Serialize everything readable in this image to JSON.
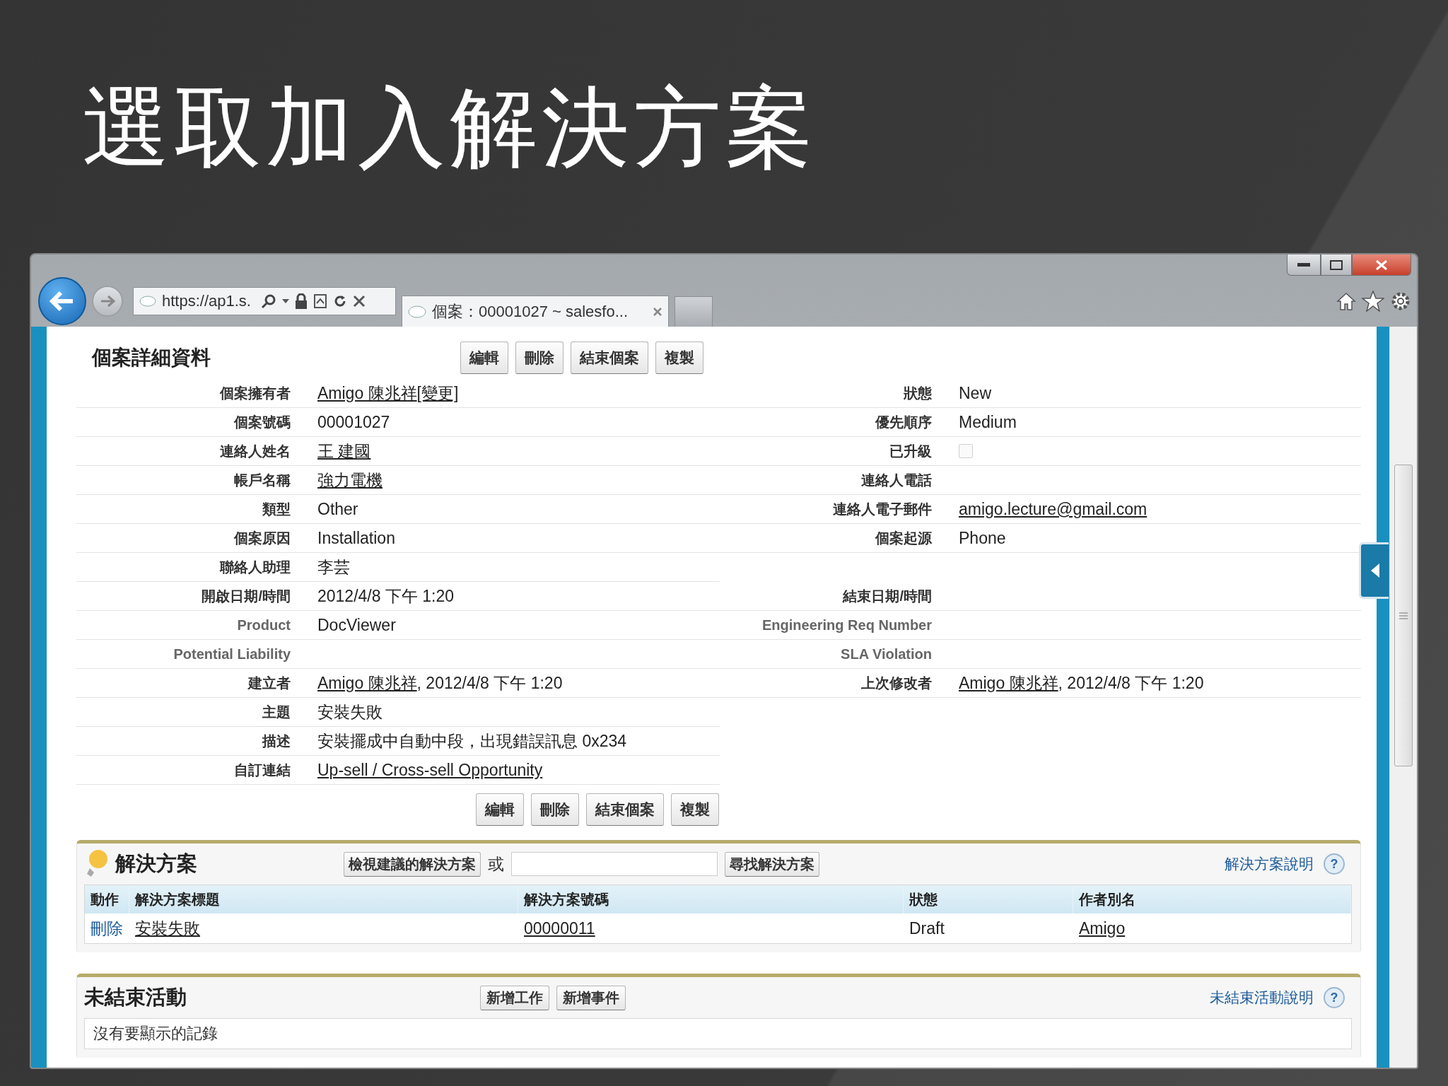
{
  "slide": {
    "title": "選取加入解決方案"
  },
  "browser": {
    "address": "https://ap1.s.",
    "tab": {
      "title": "個案：00001027 ~ salesfo...",
      "selected": true
    }
  },
  "detail": {
    "title": "個案詳細資料",
    "buttons": [
      "編輯",
      "刪除",
      "結束個案",
      "複製"
    ],
    "rows": [
      {
        "left": {
          "label": "個案擁有者",
          "custom": false,
          "value": [
            {
              "text": "Amigo 陳兆祥",
              "link": true
            },
            {
              "text": "[變更]",
              "link": true
            }
          ]
        },
        "right": {
          "label": "狀態",
          "custom": false,
          "value": [
            {
              "text": "New",
              "link": false
            }
          ]
        }
      },
      {
        "left": {
          "label": "個案號碼",
          "custom": false,
          "value": [
            {
              "text": "00001027",
              "link": false
            }
          ]
        },
        "right": {
          "label": "優先順序",
          "custom": false,
          "value": [
            {
              "text": "Medium",
              "link": false
            }
          ]
        }
      },
      {
        "left": {
          "label": "連絡人姓名",
          "custom": false,
          "value": [
            {
              "text": "王 建國",
              "link": true
            }
          ]
        },
        "right": {
          "label": "已升級",
          "custom": false,
          "kind": "checkbox",
          "checked": false
        }
      },
      {
        "left": {
          "label": "帳戶名稱",
          "custom": false,
          "value": [
            {
              "text": "強力電機",
              "link": true
            }
          ]
        },
        "right": {
          "label": "連絡人電話",
          "custom": false
        }
      },
      {
        "left": {
          "label": "類型",
          "custom": false,
          "value": [
            {
              "text": "Other",
              "link": false
            }
          ]
        },
        "right": {
          "label": "連絡人電子郵件",
          "custom": false,
          "value": [
            {
              "text": "amigo.lecture@gmail.com",
              "link": true
            }
          ]
        }
      },
      {
        "left": {
          "label": "個案原因",
          "custom": false,
          "value": [
            {
              "text": "Installation",
              "link": false
            }
          ]
        },
        "right": {
          "label": "個案起源",
          "custom": false,
          "value": [
            {
              "text": "Phone",
              "link": false
            }
          ]
        }
      },
      {
        "left": {
          "label": "聯絡人助理",
          "custom": false,
          "value": [
            {
              "text": "李芸",
              "link": false
            }
          ]
        }
      },
      {
        "left": {
          "label": "開啟日期/時間",
          "custom": false,
          "value": [
            {
              "text": "2012/4/8 下午 1:20",
              "link": false
            }
          ]
        },
        "right": {
          "label": "結束日期/時間",
          "custom": false
        }
      },
      {
        "left": {
          "label": "Product",
          "custom": true,
          "value": [
            {
              "text": "DocViewer",
              "link": false
            }
          ]
        },
        "right": {
          "label": "Engineering Req Number",
          "custom": true
        }
      },
      {
        "left": {
          "label": "Potential Liability",
          "custom": true
        },
        "right": {
          "label": "SLA Violation",
          "custom": true
        }
      },
      {
        "left": {
          "label": "建立者",
          "custom": false,
          "value": [
            {
              "text": "Amigo 陳兆祥",
              "link": true
            },
            {
              "text": ", 2012/4/8 下午 1:20",
              "link": false
            }
          ]
        },
        "right": {
          "label": "上次修改者",
          "custom": false,
          "value": [
            {
              "text": "Amigo 陳兆祥",
              "link": true
            },
            {
              "text": ", 2012/4/8 下午 1:20",
              "link": false
            }
          ]
        }
      },
      {
        "left": {
          "label": "主題",
          "custom": false,
          "value": [
            {
              "text": "安裝失敗",
              "link": false
            }
          ]
        }
      },
      {
        "left": {
          "label": "描述",
          "custom": false,
          "value": [
            {
              "text": "安裝擺成中自動中段，出現錯誤訊息 0x234",
              "link": false
            }
          ]
        }
      },
      {
        "left": {
          "label": "自訂連結",
          "custom": false,
          "value": [
            {
              "text": "Up-sell / Cross-sell Opportunity",
              "link": true
            }
          ]
        }
      }
    ],
    "bottom_buttons": [
      "編輯",
      "刪除",
      "結束個案",
      "複製"
    ]
  },
  "solutions": {
    "title": "解決方案",
    "view_button": "檢視建議的解決方案",
    "or": "或",
    "find_button": "尋找解決方案",
    "help": "解決方案說明",
    "help_icon": "?",
    "columns": [
      "動作",
      "解決方案標題",
      "解決方案號碼",
      "狀態",
      "作者別名"
    ],
    "rows": [
      {
        "action": "刪除",
        "title": "安裝失敗",
        "number": "00000011",
        "status": "Draft",
        "author": "Amigo"
      }
    ]
  },
  "activities": {
    "title": "未結束活動",
    "buttons": [
      "新增工作",
      "新增事件"
    ],
    "help": "未結束活動說明",
    "help_icon": "?",
    "empty": "沒有要顯示的記錄"
  }
}
